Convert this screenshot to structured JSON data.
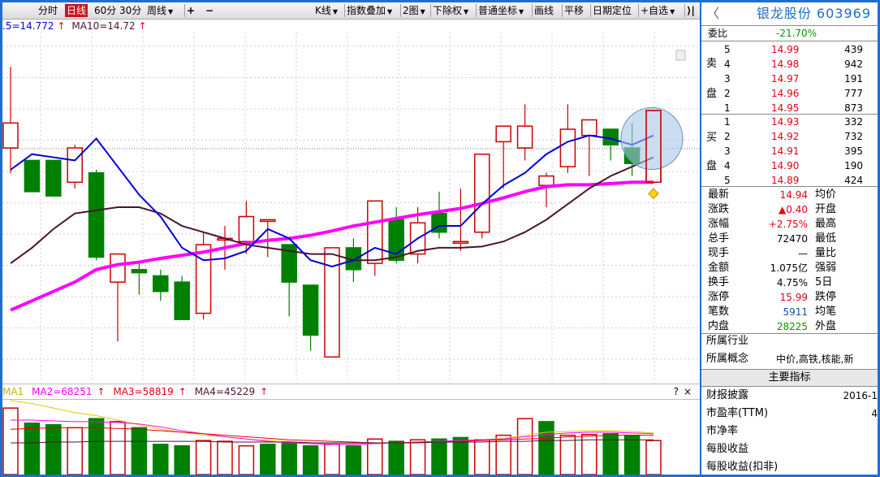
{
  "toolbar": {
    "items": [
      "分时",
      "日线",
      "60分",
      "30分",
      "周线",
      "+",
      "−",
      "K线",
      "指数叠加",
      "2图",
      "下除权",
      "普通坐标",
      "画线",
      "平移",
      "日期定位",
      "+自选"
    ],
    "active": "日线"
  },
  "ma_labels": {
    "ma10": "MA10=14.72"
  },
  "volume_labels": {
    "ma2": "MA2=68251",
    "ma3": "MA3=58819",
    "ma4": "MA4=45229",
    "help": "?",
    "close": "×"
  },
  "stock": {
    "back_icon": "back-arrow-icon",
    "title": "银龙股份 603969"
  },
  "order_book": {
    "weibi_label": "委比",
    "weibi_value": "-21.70%",
    "sell_label": [
      "卖",
      "盘"
    ],
    "buy_label": [
      "买",
      "盘"
    ],
    "asks": [
      {
        "level": "5",
        "price": "14.99",
        "volume": "439"
      },
      {
        "level": "4",
        "price": "14.98",
        "volume": "942"
      },
      {
        "level": "3",
        "price": "14.97",
        "volume": "191"
      },
      {
        "level": "2",
        "price": "14.96",
        "volume": "777"
      },
      {
        "level": "1",
        "price": "14.95",
        "volume": "873"
      }
    ],
    "bids": [
      {
        "level": "1",
        "price": "14.93",
        "volume": "332"
      },
      {
        "level": "2",
        "price": "14.92",
        "volume": "732"
      },
      {
        "level": "3",
        "price": "14.91",
        "volume": "395"
      },
      {
        "level": "4",
        "price": "14.90",
        "volume": "190"
      },
      {
        "level": "5",
        "price": "14.89",
        "volume": "424"
      }
    ]
  },
  "quote": [
    {
      "label": "最新",
      "value": "14.94",
      "color": "red",
      "label2": "均价"
    },
    {
      "label": "涨跌",
      "value": "▲0.40",
      "color": "red",
      "label2": "开盘"
    },
    {
      "label": "涨幅",
      "value": "+2.75%",
      "color": "red",
      "label2": "最高"
    },
    {
      "label": "总手",
      "value": "72470",
      "color": "black",
      "label2": "最低"
    },
    {
      "label": "现手",
      "value": "—",
      "color": "black",
      "label2": "量比"
    },
    {
      "label": "金额",
      "value": "1.075亿",
      "color": "black",
      "label2": "强弱"
    },
    {
      "label": "换手",
      "value": "4.75%",
      "color": "black",
      "label2": "5日"
    },
    {
      "label": "涨停",
      "value": "15.99",
      "color": "red",
      "label2": "跌停"
    },
    {
      "label": "笔数",
      "value": "5911",
      "color": "blue",
      "label2": "均笔"
    },
    {
      "label": "内盘",
      "value": "28225",
      "color": "green",
      "label2": "外盘"
    }
  ],
  "info": {
    "industry_label": "所属行业",
    "concept_label": "所属概念",
    "concept_value": "中价,高铁,核能,新",
    "main_indicators": "主要指标",
    "rows": [
      {
        "label": "财报披露",
        "value": "2016-1"
      },
      {
        "label": "市盈率(TTM)",
        "value": "4"
      },
      {
        "label": "市净率",
        "value": ""
      },
      {
        "label": "每股收益",
        "value": ""
      },
      {
        "label": "每股收益(扣非)",
        "value": ""
      }
    ]
  },
  "chart_data": {
    "type": "candlestick",
    "note_colors": {
      "up": "#cc0000",
      "down": "#008000",
      "ma5": "#0000dd",
      "ma10": "#4b1530",
      "ma20": "#ff00ff"
    },
    "candles": [
      {
        "o": 14.55,
        "h": 15.85,
        "l": 14.15,
        "c": 14.95
      },
      {
        "o": 14.35,
        "h": 14.35,
        "l": 14.05,
        "c": 13.85
      },
      {
        "o": 14.35,
        "h": 14.35,
        "l": 13.78,
        "c": 13.78
      },
      {
        "o": 14.0,
        "h": 14.6,
        "l": 13.9,
        "c": 14.55
      },
      {
        "o": 14.15,
        "h": 14.2,
        "l": 12.75,
        "c": 12.8
      },
      {
        "o": 12.4,
        "h": 12.7,
        "l": 11.45,
        "c": 12.85
      },
      {
        "o": 12.6,
        "h": 12.72,
        "l": 12.2,
        "c": 12.55
      },
      {
        "o": 12.5,
        "h": 12.6,
        "l": 12.1,
        "c": 12.25
      },
      {
        "o": 12.4,
        "h": 12.5,
        "l": 11.9,
        "c": 11.8
      },
      {
        "o": 11.9,
        "h": 13.2,
        "l": 11.8,
        "c": 13.0
      },
      {
        "o": 13.1,
        "h": 13.3,
        "l": 12.6,
        "c": 13.1
      },
      {
        "o": 13.05,
        "h": 13.7,
        "l": 12.85,
        "c": 13.45
      },
      {
        "o": 13.4,
        "h": 13.4,
        "l": 12.8,
        "c": 13.4
      },
      {
        "o": 13.0,
        "h": 13.0,
        "l": 11.85,
        "c": 12.4
      },
      {
        "o": 12.35,
        "h": 12.35,
        "l": 11.3,
        "c": 11.55
      },
      {
        "o": 11.2,
        "h": 12.9,
        "l": 11.2,
        "c": 12.95
      },
      {
        "o": 12.95,
        "h": 13.1,
        "l": 12.4,
        "c": 12.6
      },
      {
        "o": 12.7,
        "h": 13.7,
        "l": 12.5,
        "c": 13.7
      },
      {
        "o": 13.4,
        "h": 13.6,
        "l": 12.7,
        "c": 12.75
      },
      {
        "o": 12.85,
        "h": 13.6,
        "l": 12.7,
        "c": 13.35
      },
      {
        "o": 13.5,
        "h": 13.85,
        "l": 13.1,
        "c": 13.2
      },
      {
        "o": 13.05,
        "h": 13.9,
        "l": 12.9,
        "c": 13.05
      },
      {
        "o": 13.2,
        "h": 14.15,
        "l": 13.1,
        "c": 14.45
      },
      {
        "o": 14.65,
        "h": 14.75,
        "l": 13.9,
        "c": 14.9
      },
      {
        "o": 14.55,
        "h": 15.25,
        "l": 14.35,
        "c": 14.9
      },
      {
        "o": 13.95,
        "h": 14.15,
        "l": 13.6,
        "c": 14.1
      },
      {
        "o": 14.25,
        "h": 15.25,
        "l": 14.15,
        "c": 14.85
      },
      {
        "o": 14.75,
        "h": 15.0,
        "l": 14.1,
        "c": 15.0
      },
      {
        "o": 14.85,
        "h": 14.85,
        "l": 14.35,
        "c": 14.6
      },
      {
        "o": 14.55,
        "h": 14.95,
        "l": 14.1,
        "c": 14.3
      },
      {
        "o": 14.0,
        "h": 15.15,
        "l": 14.0,
        "c": 15.15
      }
    ],
    "ma5": [
      14.2,
      14.45,
      14.4,
      14.35,
      14.7,
      14.25,
      13.8,
      13.45,
      12.95,
      12.75,
      12.78,
      12.9,
      13.25,
      13.1,
      12.75,
      12.65,
      12.75,
      12.95,
      12.85,
      13.1,
      13.3,
      13.3,
      13.65,
      13.95,
      14.15,
      14.45,
      14.65,
      14.75,
      14.7,
      14.6,
      14.75
    ],
    "ma10": [
      12.7,
      12.95,
      13.25,
      13.5,
      13.55,
      13.6,
      13.6,
      13.5,
      13.3,
      13.2,
      13.1,
      13.0,
      12.95,
      12.9,
      12.85,
      12.85,
      12.75,
      12.75,
      12.8,
      12.9,
      12.95,
      12.95,
      12.97,
      13.05,
      13.2,
      13.4,
      13.65,
      13.9,
      14.1,
      14.25,
      14.4
    ],
    "ma20": [
      11.95,
      12.1,
      12.25,
      12.4,
      12.6,
      12.68,
      12.72,
      12.78,
      12.83,
      12.88,
      12.95,
      13.02,
      13.07,
      13.1,
      13.15,
      13.22,
      13.3,
      13.36,
      13.42,
      13.48,
      13.53,
      13.58,
      13.66,
      13.75,
      13.85,
      13.93,
      13.96,
      13.96,
      13.98,
      14.0,
      14.0
    ],
    "ylim": [
      10.8,
      16.4
    ],
    "volume": {
      "values": [
        88,
        68,
        66,
        62,
        74,
        70,
        62,
        40,
        38,
        45,
        44,
        38,
        40,
        41,
        38,
        40,
        38,
        47,
        44,
        46,
        47,
        49,
        46,
        52,
        74,
        70,
        52,
        53,
        54,
        52,
        45
      ],
      "up": [
        true,
        false,
        false,
        true,
        false,
        true,
        false,
        false,
        false,
        true,
        true,
        true,
        false,
        false,
        false,
        true,
        false,
        true,
        false,
        true,
        false,
        false,
        true,
        true,
        true,
        false,
        true,
        true,
        false,
        false,
        true
      ],
      "ylim": [
        0,
        100
      ]
    }
  }
}
